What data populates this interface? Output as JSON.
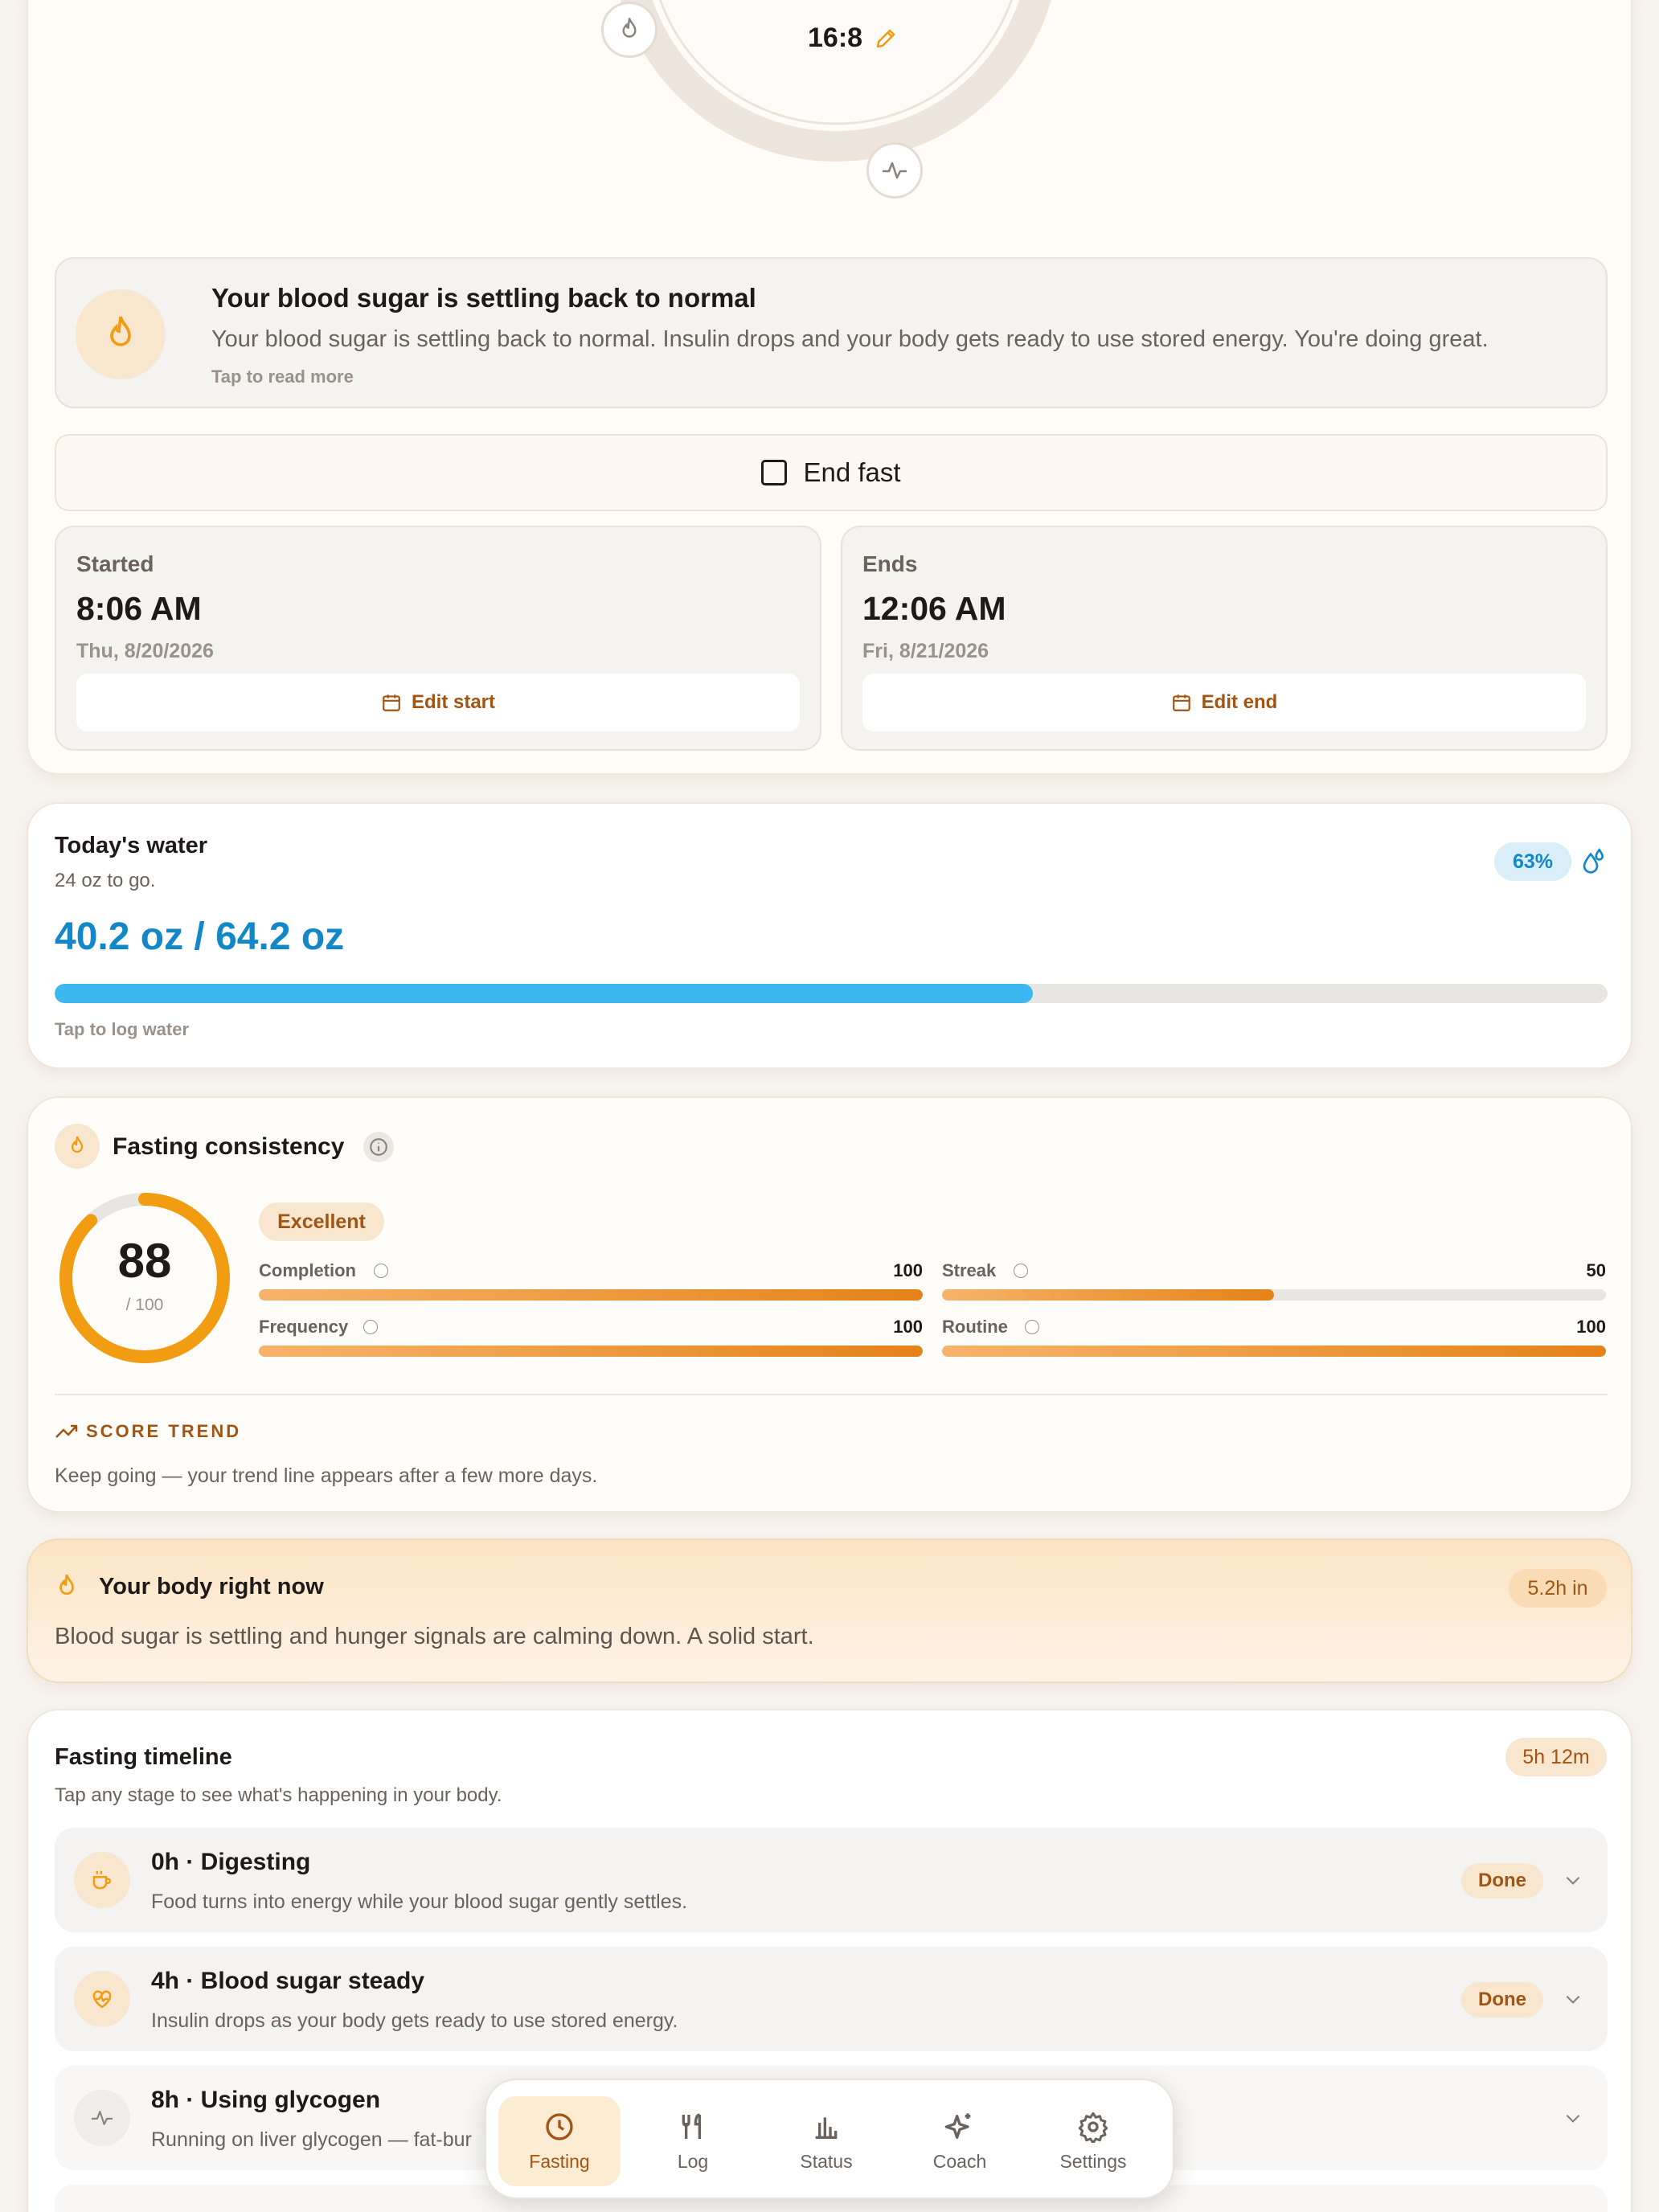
{
  "timer": {
    "plan_label": "16:8"
  },
  "stage_banner": {
    "title": "Your blood sugar is settling back to normal",
    "body": "Your blood sugar is settling back to normal. Insulin drops and your body gets ready to use stored energy. You're doing great.",
    "hint": "Tap to read more"
  },
  "end_fast": {
    "label": "End fast"
  },
  "started": {
    "label": "Started",
    "time": "8:06 AM",
    "date": "Thu, 8/20/2026",
    "edit_label": "Edit start"
  },
  "ends": {
    "label": "Ends",
    "time": "12:06 AM",
    "date": "Fri, 8/21/2026",
    "edit_label": "Edit end"
  },
  "water": {
    "title": "Today's water",
    "remaining": "24 oz to go.",
    "amount": "40.2 oz / 64.2 oz",
    "percent_label": "63%",
    "progress": 0.63,
    "hint": "Tap to log water",
    "color": "#1388c9"
  },
  "consistency": {
    "title": "Fasting consistency",
    "score": "88",
    "score_max": "/ 100",
    "score_value": 88,
    "rating": "Excellent",
    "metrics": [
      {
        "label": "Completion",
        "value": "100",
        "progress": 1.0
      },
      {
        "label": "Streak",
        "value": "50",
        "progress": 0.5
      },
      {
        "label": "Frequency",
        "value": "100",
        "progress": 1.0
      },
      {
        "label": "Routine",
        "value": "100",
        "progress": 1.0
      }
    ],
    "trend_title": "SCORE TREND",
    "trend_text": "Keep going — your trend line appears after a few more days."
  },
  "body_now": {
    "title": "Your body right now",
    "badge": "5.2h in",
    "text": "Blood sugar is settling and hunger signals are calming down. A solid start."
  },
  "timeline": {
    "title": "Fasting timeline",
    "badge": "5h 12m",
    "subtitle": "Tap any stage to see what's happening in your body.",
    "stages": [
      {
        "title": "0h · Digesting",
        "desc": "Food turns into energy while your blood sugar gently settles.",
        "status": "Done",
        "icon": "coffee-cup-icon"
      },
      {
        "title": "4h · Blood sugar steady",
        "desc": "Insulin drops as your body gets ready to use stored energy.",
        "status": "Done",
        "icon": "heart-pulse-icon"
      },
      {
        "title": "8h · Using glycogen",
        "desc": "Running on liver glycogen — fat-bur",
        "status": "",
        "icon": "pulse-icon"
      }
    ]
  },
  "nav": {
    "items": [
      {
        "label": "Fasting",
        "icon": "clock-icon",
        "active": true
      },
      {
        "label": "Log",
        "icon": "fork-knife-icon",
        "active": false
      },
      {
        "label": "Status",
        "icon": "bar-chart-icon",
        "active": false
      },
      {
        "label": "Coach",
        "icon": "sparkle-icon",
        "active": false
      },
      {
        "label": "Settings",
        "icon": "gear-icon",
        "active": false
      }
    ]
  },
  "colors": {
    "accent": "#f29c11",
    "accent_dark": "#a25412",
    "water_bar": "#3db7f0"
  }
}
